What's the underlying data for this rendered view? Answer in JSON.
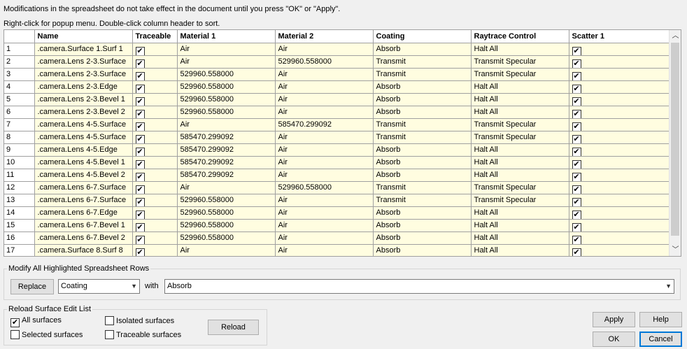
{
  "notes": {
    "line1": "Modifications in the spreadsheet do not take effect in the document until you press \"OK\" or \"Apply\".",
    "line2": "Right-click for popup menu.    Double-click column header to sort."
  },
  "grid": {
    "columns": [
      "",
      "Name",
      "Traceable",
      "Material 1",
      "Material 2",
      "Coating",
      "Raytrace Control",
      "Scatter 1"
    ],
    "rows": [
      {
        "n": "1",
        "name": ".camera.Surface 1.Surf 1",
        "m1": "Air",
        "m2": "Air",
        "coating": "Absorb",
        "rc": "Halt All"
      },
      {
        "n": "2",
        "name": ".camera.Lens 2-3.Surface",
        "m1": "Air",
        "m2": "529960.558000",
        "coating": "Transmit",
        "rc": "Transmit Specular"
      },
      {
        "n": "3",
        "name": ".camera.Lens 2-3.Surface",
        "m1": "529960.558000",
        "m2": "Air",
        "coating": "Transmit",
        "rc": "Transmit Specular"
      },
      {
        "n": "4",
        "name": ".camera.Lens 2-3.Edge",
        "m1": "529960.558000",
        "m2": "Air",
        "coating": "Absorb",
        "rc": "Halt All"
      },
      {
        "n": "5",
        "name": ".camera.Lens 2-3.Bevel 1",
        "m1": "529960.558000",
        "m2": "Air",
        "coating": "Absorb",
        "rc": "Halt All"
      },
      {
        "n": "6",
        "name": ".camera.Lens 2-3.Bevel 2",
        "m1": "529960.558000",
        "m2": "Air",
        "coating": "Absorb",
        "rc": "Halt All"
      },
      {
        "n": "7",
        "name": ".camera.Lens 4-5.Surface",
        "m1": "Air",
        "m2": "585470.299092",
        "coating": "Transmit",
        "rc": "Transmit Specular"
      },
      {
        "n": "8",
        "name": ".camera.Lens 4-5.Surface",
        "m1": "585470.299092",
        "m2": "Air",
        "coating": "Transmit",
        "rc": "Transmit Specular"
      },
      {
        "n": "9",
        "name": ".camera.Lens 4-5.Edge",
        "m1": "585470.299092",
        "m2": "Air",
        "coating": "Absorb",
        "rc": "Halt All"
      },
      {
        "n": "10",
        "name": ".camera.Lens 4-5.Bevel 1",
        "m1": "585470.299092",
        "m2": "Air",
        "coating": "Absorb",
        "rc": "Halt All"
      },
      {
        "n": "11",
        "name": ".camera.Lens 4-5.Bevel 2",
        "m1": "585470.299092",
        "m2": "Air",
        "coating": "Absorb",
        "rc": "Halt All"
      },
      {
        "n": "12",
        "name": ".camera.Lens 6-7.Surface",
        "m1": "Air",
        "m2": "529960.558000",
        "coating": "Transmit",
        "rc": "Transmit Specular"
      },
      {
        "n": "13",
        "name": ".camera.Lens 6-7.Surface",
        "m1": "529960.558000",
        "m2": "Air",
        "coating": "Transmit",
        "rc": "Transmit Specular"
      },
      {
        "n": "14",
        "name": ".camera.Lens 6-7.Edge",
        "m1": "529960.558000",
        "m2": "Air",
        "coating": "Absorb",
        "rc": "Halt All"
      },
      {
        "n": "15",
        "name": ".camera.Lens 6-7.Bevel 1",
        "m1": "529960.558000",
        "m2": "Air",
        "coating": "Absorb",
        "rc": "Halt All"
      },
      {
        "n": "16",
        "name": ".camera.Lens 6-7.Bevel 2",
        "m1": "529960.558000",
        "m2": "Air",
        "coating": "Absorb",
        "rc": "Halt All"
      },
      {
        "n": "17",
        "name": ".camera.Surface 8.Surf 8",
        "m1": "Air",
        "m2": "Air",
        "coating": "Absorb",
        "rc": "Halt All"
      }
    ],
    "check_mark": "✔",
    "row_bg": "#fffde0"
  },
  "modify": {
    "legend": "Modify All Highlighted Spreadsheet Rows",
    "replace_label": "Replace",
    "field_value": "Coating",
    "with_label": "with",
    "value": "Absorb"
  },
  "reload": {
    "legend": "Reload Surface Edit List",
    "all_label": "All surfaces",
    "selected_label": "Selected surfaces",
    "isolated_label": "Isolated surfaces",
    "traceable_label": "Traceable surfaces",
    "reload_label": "Reload",
    "all_checked": true
  },
  "buttons": {
    "apply": "Apply",
    "help": "Help",
    "ok": "OK",
    "cancel": "Cancel"
  },
  "icons": {
    "dropdown": "chevron-down-icon",
    "scroll_up": "chevron-up-icon",
    "scroll_down": "chevron-down-icon",
    "check": "check-icon"
  }
}
